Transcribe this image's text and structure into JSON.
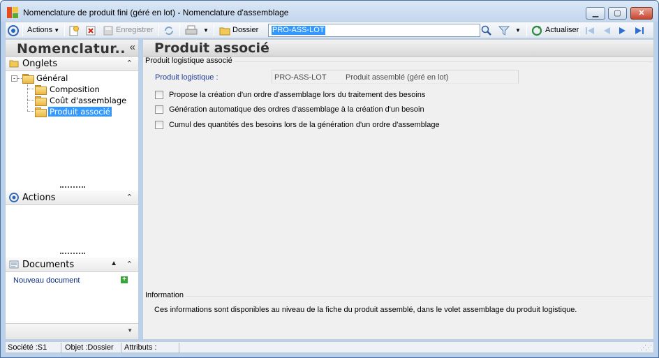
{
  "window": {
    "title": "Nomenclature de produit fini (géré en lot) -  Nomenclature d'assemblage"
  },
  "toolbar": {
    "actions_label": "Actions",
    "save_label": "Enregistrer",
    "folder_label": "Dossier",
    "search_value": "PRO-ASS-LOT",
    "refresh_label": "Actualiser"
  },
  "left_panel": {
    "title": "Nomenclatur..",
    "collapse_glyph": "«",
    "sections": {
      "tabs": {
        "title": "Onglets",
        "tree": {
          "root": "Général",
          "children": [
            "Composition",
            "Coût d'assemblage",
            "Produit associé"
          ]
        }
      },
      "actions": {
        "title": "Actions"
      },
      "documents": {
        "title": "Documents",
        "new_document": "Nouveau document"
      }
    }
  },
  "main": {
    "title": "Produit associé",
    "group1_title": "Produit logistique associé",
    "field_label": "Produit logistique :",
    "field_code": "PRO-ASS-LOT",
    "field_name": "Produit assemblé (géré en lot)",
    "checkboxes": [
      "Propose la création d'un ordre d'assemblage lors du traitement des besoins",
      "Génération automatique des ordres d'assemblage à la création d'un besoin",
      "Cumul des quantités des besoins lors de la génération d'un ordre d'assemblage"
    ],
    "group2_title": "Information",
    "info_text": "Ces informations sont disponibles au niveau de la fiche du produit assemblé, dans le volet assemblage du produit logistique."
  },
  "status": {
    "company": "Société :S1",
    "object": "Objet :Dossier",
    "attributes": "Attributs :"
  }
}
